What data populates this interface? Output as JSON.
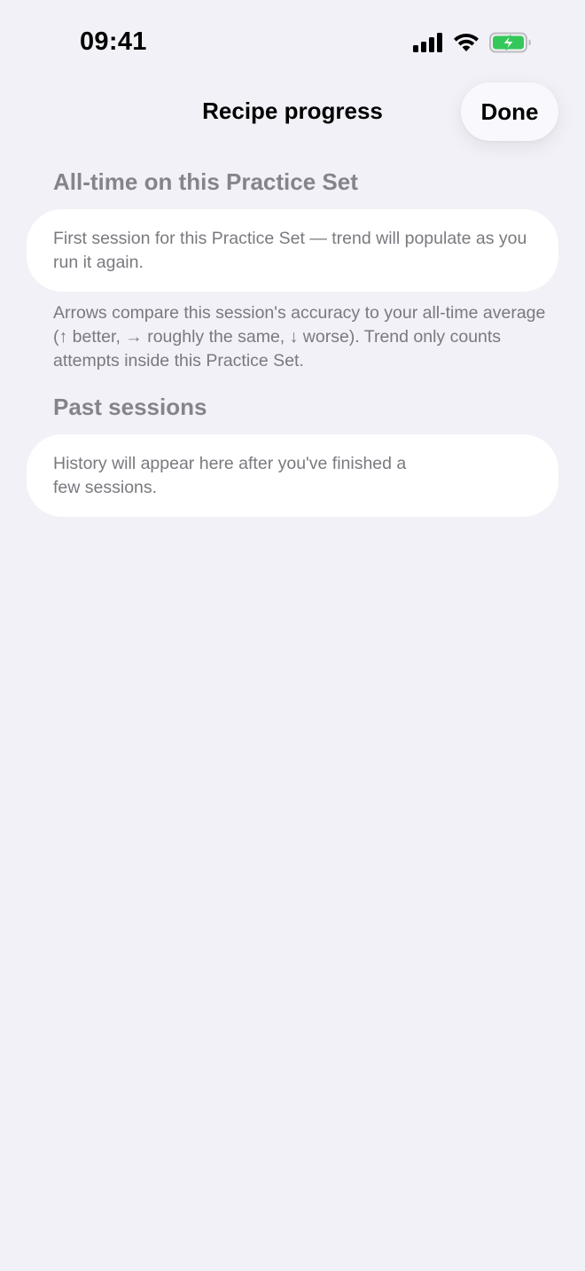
{
  "status_bar": {
    "time": "09:41",
    "icons": [
      "cellular-signal-icon",
      "wifi-icon",
      "battery-charging-icon"
    ],
    "battery_color": "#34C759"
  },
  "nav": {
    "title": "Recipe progress",
    "done_label": "Done"
  },
  "sections": {
    "all_time": {
      "header": "All-time on this Practice Set",
      "card_text": "First session for this Practice Set — trend will populate as you run it again.",
      "footer": "Arrows compare this session's accuracy to your all-time average (↑ better, → roughly the same, ↓ worse). Trend only counts attempts inside this Practice Set."
    },
    "past_sessions": {
      "header": "Past sessions",
      "card_text": "History will appear here after you've finished a few sessions."
    }
  }
}
